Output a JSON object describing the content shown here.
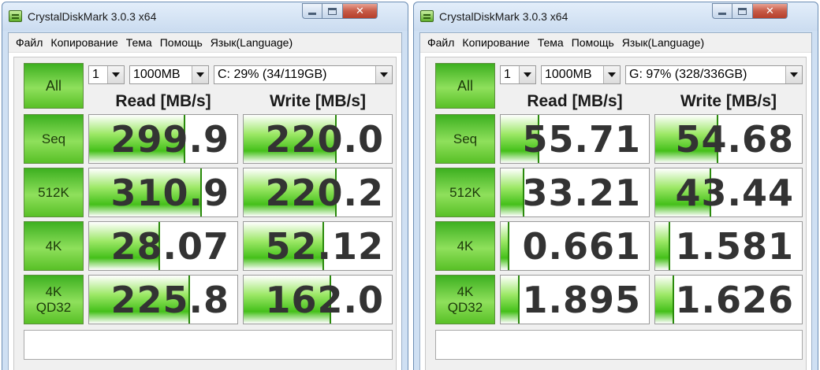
{
  "windows": [
    {
      "title": "CrystalDiskMark 3.0.3 x64",
      "menu": [
        "Файл",
        "Копирование",
        "Тема",
        "Помощь",
        "Язык(Language)"
      ],
      "all_button": "All",
      "test_count": "1",
      "test_size": "1000MB",
      "drive": "C: 29% (34/119GB)",
      "read_header": "Read [MB/s]",
      "write_header": "Write [MB/s]",
      "rows": [
        {
          "label": "Seq",
          "read": "299.9",
          "write": "220.0"
        },
        {
          "label": "512K",
          "read": "310.9",
          "write": "220.2"
        },
        {
          "label": "4K",
          "read": "28.07",
          "write": "52.12"
        },
        {
          "label": "4K\nQD32",
          "read": "225.8",
          "write": "162.0"
        }
      ],
      "comment": ""
    },
    {
      "title": "CrystalDiskMark 3.0.3 x64",
      "menu": [
        "Файл",
        "Копирование",
        "Тема",
        "Помощь",
        "Язык(Language)"
      ],
      "all_button": "All",
      "test_count": "1",
      "test_size": "1000MB",
      "drive": "G: 97% (328/336GB)",
      "read_header": "Read [MB/s]",
      "write_header": "Write [MB/s]",
      "rows": [
        {
          "label": "Seq",
          "read": "55.71",
          "write": "54.68"
        },
        {
          "label": "512K",
          "read": "33.21",
          "write": "43.44"
        },
        {
          "label": "4K",
          "read": "0.661",
          "write": "1.581"
        },
        {
          "label": "4K\nQD32",
          "read": "1.895",
          "write": "1.626"
        }
      ],
      "comment": ""
    }
  ],
  "bar_fill_fractions": [
    {
      "read": [
        0.65,
        0.76,
        0.48,
        0.68
      ],
      "write": [
        0.63,
        0.63,
        0.54,
        0.59
      ]
    },
    {
      "read": [
        0.26,
        0.16,
        0.06,
        0.13
      ],
      "write": [
        0.43,
        0.38,
        0.1,
        0.13
      ]
    }
  ]
}
